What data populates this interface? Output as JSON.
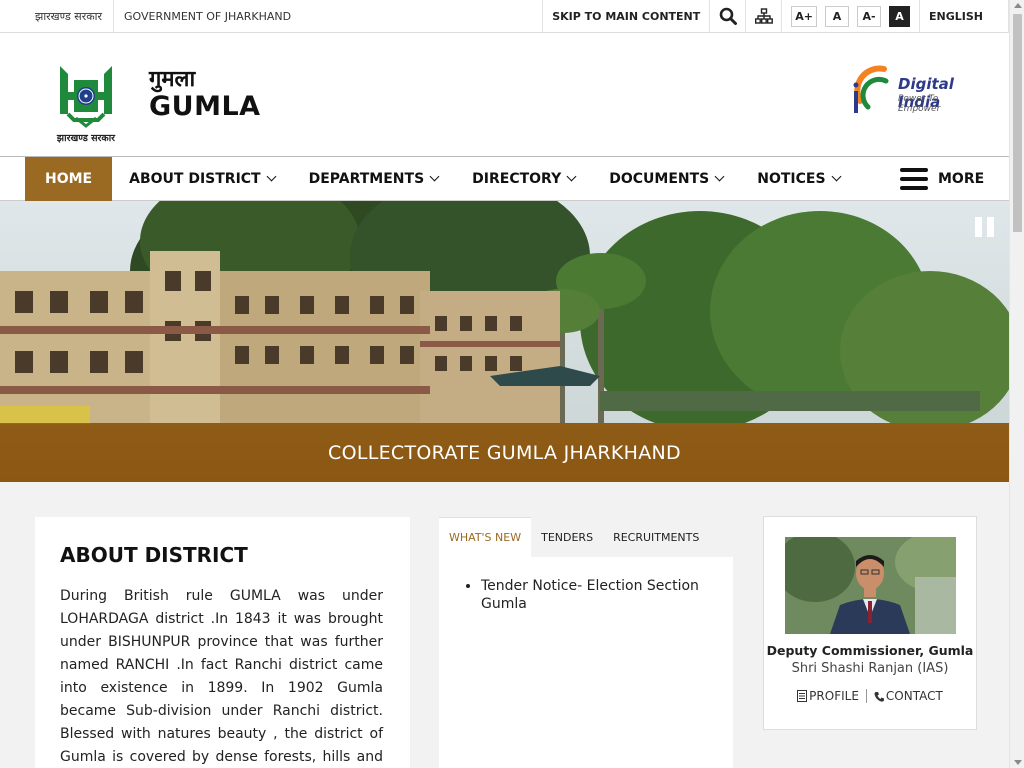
{
  "topbar": {
    "gov_hindi": "झारखण्ड सरकार",
    "gov_english": "GOVERNMENT OF JHARKHAND",
    "skip": "SKIP TO MAIN CONTENT",
    "font_increase": "A+",
    "font_normal": "A",
    "font_decrease": "A-",
    "contrast": "A",
    "language": "ENGLISH"
  },
  "header": {
    "logo_caption": "झारखण्ड सरकार",
    "site_name_hindi": "गुमला",
    "site_name": "GUMLA",
    "digital_india_title": "Digital India",
    "digital_india_sub": "Power To Empower"
  },
  "nav": {
    "items": [
      {
        "label": "HOME"
      },
      {
        "label": "ABOUT DISTRICT"
      },
      {
        "label": "DEPARTMENTS"
      },
      {
        "label": "DIRECTORY"
      },
      {
        "label": "DOCUMENTS"
      },
      {
        "label": "NOTICES"
      }
    ],
    "more": "MORE"
  },
  "hero": {
    "caption": "COLLECTORATE GUMLA JHARKHAND"
  },
  "about": {
    "title": "ABOUT DISTRICT",
    "text": "During British rule GUMLA was under LOHARDAGA district .In 1843 it was brought under BISHUNPUR province that was further named RANCHI .In fact Ranchi district came into existence in 1899. In 1902 Gumla became Sub-division under Ranchi district. Blessed with natures beauty , the district of Gumla is covered by dense forests, hills and rivers. It is situated"
  },
  "news": {
    "tabs": [
      "WHAT'S NEW",
      "TENDERS",
      "RECRUITMENTS"
    ],
    "items": [
      "Tender Notice- Election Section Gumla"
    ]
  },
  "dc": {
    "role": "Deputy Commissioner, Gumla",
    "name": "Shri Shashi Ranjan (IAS)",
    "profile": "PROFILE",
    "contact": "CONTACT"
  },
  "colors": {
    "accent": "#9a6a23",
    "caption_bg": "#965c10",
    "logo_green": "#1f8a3c"
  }
}
